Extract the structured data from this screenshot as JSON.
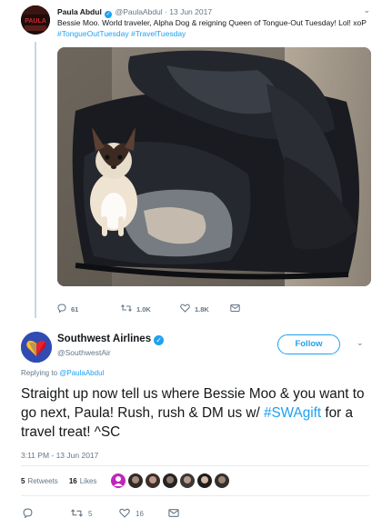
{
  "parent_tweet": {
    "author_name": "Paula Abdul",
    "author_handle": "@PaulaAbdul",
    "separator": "·",
    "date": "13 Jun 2017",
    "text_plain": "Bessie Moo. World traveler, Alpha Dog & reigning Queen of Tongue-Out Tuesday! Lol! xoP",
    "hashtag_1": "#TongueOutTuesday",
    "hashtag_2": "#TravelTuesday",
    "reply_count": "61",
    "retweet_count": "1.0K",
    "like_count": "1.8K",
    "avatar_text": "PAULA"
  },
  "main_tweet": {
    "author_name": "Southwest Airlines",
    "author_handle": "@SouthwestAir",
    "follow_label": "Follow",
    "replying_prefix": "Replying to",
    "replying_handle": "@PaulaAbdul",
    "text_part1": "Straight up now tell us where Bessie Moo & you want to go next, Paula! Rush, rush & DM us w/",
    "hashtag": "#SWAgift",
    "text_part2": "for a travel treat! ^SC",
    "timestamp": "3:11 PM - 13 Jun 2017",
    "retweets_count": "5",
    "retweets_label": "Retweets",
    "likes_count": "16",
    "likes_label": "Likes",
    "action_retweet_count": "5",
    "action_like_count": "16"
  },
  "colors": {
    "link_blue": "#1da1f2",
    "secondary_text": "#657786",
    "southwest_blue": "#304cb2",
    "southwest_red": "#c8102e",
    "southwest_yellow": "#ffbf27"
  },
  "icons": [
    "caret-down-icon",
    "verified-badge-icon",
    "reply-icon",
    "retweet-icon",
    "heart-icon",
    "message-icon"
  ]
}
